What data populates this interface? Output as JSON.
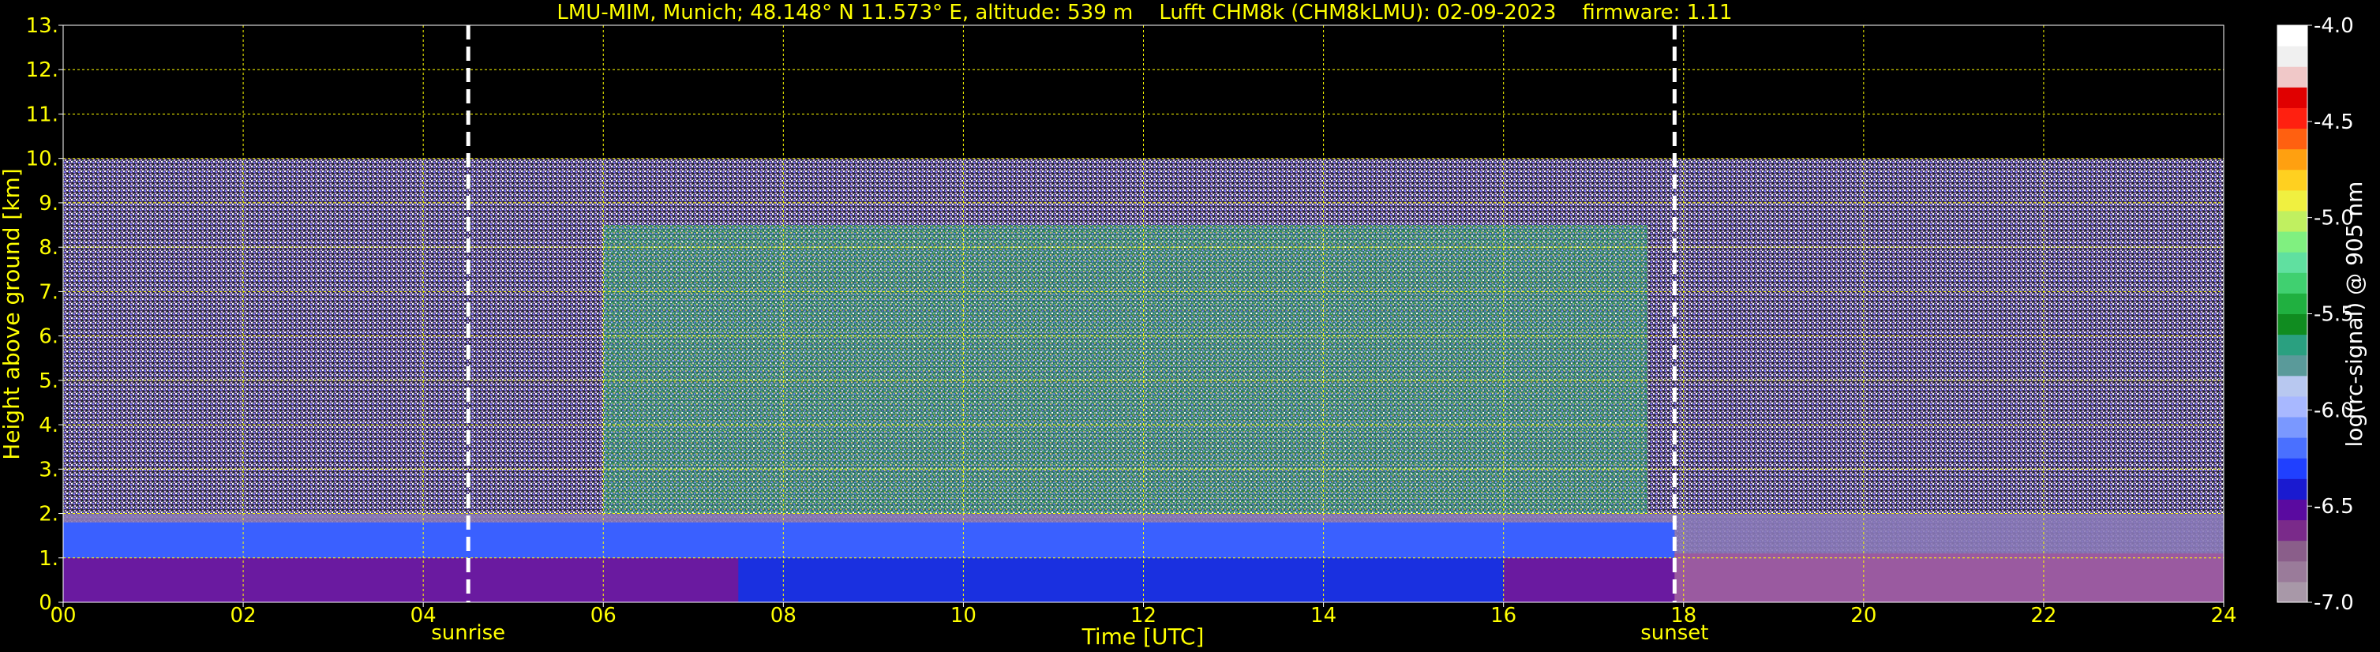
{
  "chart_data": {
    "type": "heatmap",
    "title": "LMU-MIM, Munich; 48.148° N 11.573° E, altitude: 539 m    Lufft CHM8k (CHM8kLMU): 02-09-2023    firmware: 1.11",
    "xlabel": "Time [UTC]",
    "ylabel": "Height above ground [km]",
    "xlim": [
      0,
      24
    ],
    "ylim": [
      0,
      13
    ],
    "x_ticks": [
      "00",
      "02",
      "04",
      "06",
      "08",
      "10",
      "12",
      "14",
      "16",
      "18",
      "20",
      "22",
      "24"
    ],
    "y_ticks": [
      "0.",
      "1.",
      "2.",
      "3.",
      "4.",
      "5.",
      "6.",
      "7.",
      "8.",
      "9.",
      "10.",
      "11.",
      "12.",
      "13."
    ],
    "grid": true,
    "data_top_km": 10,
    "events": [
      {
        "label": "sunrise",
        "time": 4.5
      },
      {
        "label": "sunset",
        "time": 17.9
      }
    ],
    "colorbar": {
      "label": "log(rc-signal) @ 905 nm",
      "range": [
        -7.0,
        -4.0
      ],
      "ticks": [
        "-4.0",
        "-4.5",
        "-5.0",
        "-5.5",
        "-6.0",
        "-6.5",
        "-7.0"
      ],
      "colors": [
        "#a898a8",
        "#9a7b9a",
        "#8a5e8a",
        "#7a2a8a",
        "#5a0aa0",
        "#1a1ad0",
        "#2040ff",
        "#4a70ff",
        "#7a98ff",
        "#a8b8ff",
        "#b8c8f0",
        "#5a9a9a",
        "#2aa080",
        "#108c20",
        "#20b040",
        "#40d070",
        "#60e0a0",
        "#80f080",
        "#c0f060",
        "#f0f040",
        "#ffd020",
        "#ffa010",
        "#ff6010",
        "#ff2010",
        "#e00000",
        "#f0c8c8",
        "#f0f0f0",
        "#ffffff"
      ]
    }
  }
}
